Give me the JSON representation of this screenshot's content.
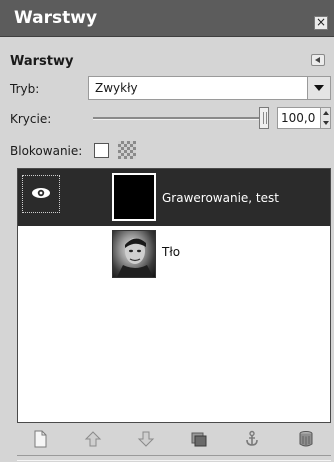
{
  "window": {
    "title": "Warstwy",
    "close_label": "×"
  },
  "dock": {
    "title": "Warstwy"
  },
  "mode": {
    "label": "Tryb:",
    "value": "Zwykły"
  },
  "opacity": {
    "label": "Krycie:",
    "value": "100,0"
  },
  "lock": {
    "label": "Blokowanie:"
  },
  "layers": [
    {
      "name": "Grawerowanie, test",
      "visible": true,
      "selected": true
    },
    {
      "name": "Tło",
      "visible": false,
      "selected": false
    }
  ],
  "toolbar_icons": [
    "new-layer-icon",
    "raise-layer-icon",
    "lower-layer-icon",
    "duplicate-layer-icon",
    "anchor-layer-icon",
    "delete-layer-icon"
  ],
  "colors": {
    "titlebar": "#5c5c5c",
    "selection": "#2b2b2b",
    "panel": "#d5d5d5"
  }
}
